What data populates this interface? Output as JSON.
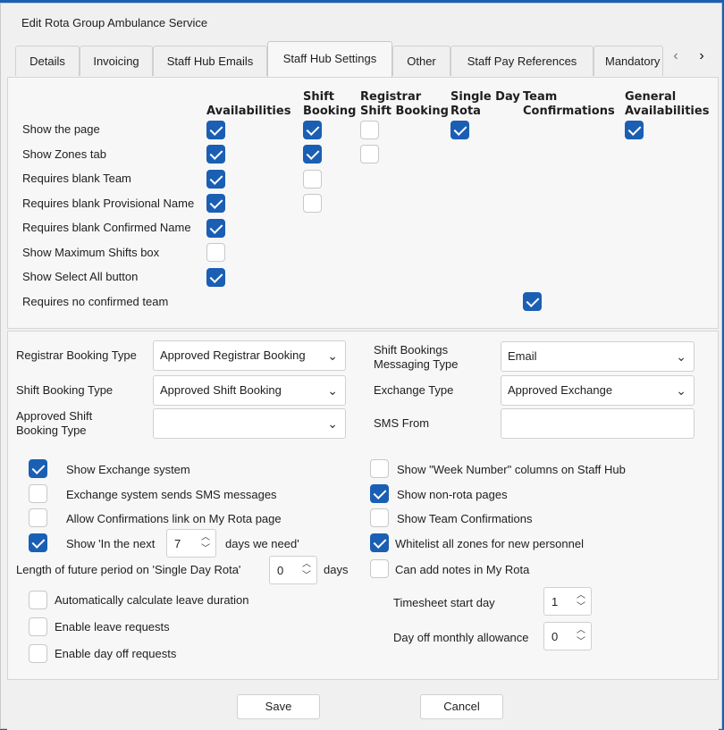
{
  "window": {
    "title": "Edit Rota Group Ambulance Service"
  },
  "tabs": [
    "Details",
    "Invoicing",
    "Staff Hub Emails",
    "Staff Hub Settings",
    "Other",
    "Staff Pay References",
    "Mandatory"
  ],
  "active_tab": "Staff Hub Settings",
  "grid": {
    "columns": [
      {
        "line1": "",
        "line2": "Availabilities"
      },
      {
        "line1": "Shift",
        "line2": "Booking"
      },
      {
        "line1": "Registrar",
        "line2": "Shift Booking"
      },
      {
        "line1": "Single Day",
        "line2": "Rota"
      },
      {
        "line1": "Team",
        "line2": "Confirmations"
      },
      {
        "line1": "General",
        "line2": "Availabilities"
      }
    ],
    "rows": [
      {
        "label": "Show the page",
        "checks": [
          true,
          true,
          false,
          true,
          null,
          true
        ]
      },
      {
        "label": "Show Zones tab",
        "checks": [
          true,
          true,
          false,
          null,
          null,
          null
        ]
      },
      {
        "label": "Requires blank Team",
        "checks": [
          true,
          false,
          null,
          null,
          null,
          null
        ]
      },
      {
        "label": "Requires blank Provisional  Name",
        "checks": [
          true,
          false,
          null,
          null,
          null,
          null
        ]
      },
      {
        "label": "Requires blank Confirmed Name",
        "checks": [
          true,
          null,
          null,
          null,
          null,
          null
        ]
      },
      {
        "label": "Show Maximum Shifts box",
        "checks": [
          false,
          null,
          null,
          null,
          null,
          null
        ]
      },
      {
        "label": "Show Select All button",
        "checks": [
          true,
          null,
          null,
          null,
          null,
          null
        ]
      },
      {
        "label": "Requires no confirmed team",
        "checks": [
          null,
          null,
          null,
          null,
          true,
          null
        ]
      }
    ]
  },
  "fields": {
    "registrar_booking_type": {
      "label": "Registrar Booking Type",
      "value": "Approved Registrar Booking"
    },
    "shift_booking_type": {
      "label": "Shift Booking Type",
      "value": "Approved Shift Booking"
    },
    "approved_shift_booking_type": {
      "label_line1": "Approved Shift",
      "label_line2": "Booking Type",
      "value": ""
    },
    "shift_bookings_messaging_type": {
      "label_line1": "Shift Bookings",
      "label_line2": "Messaging Type",
      "value": "Email"
    },
    "exchange_type": {
      "label": "Exchange Type",
      "value": "Approved Exchange"
    },
    "sms_from": {
      "label": "SMS From",
      "value": ""
    }
  },
  "options_left": {
    "show_exchange": {
      "label": "Show Exchange system",
      "checked": true
    },
    "exchange_sms": {
      "label": "Exchange system sends SMS messages",
      "checked": false
    },
    "allow_confirmations": {
      "label": "Allow Confirmations link on My Rota page",
      "checked": false
    },
    "show_in_next": {
      "label_before": "Show 'In the next",
      "value": "7",
      "label_after": "days we need'",
      "checked": true
    },
    "future_period": {
      "label_before": "Length of future period on 'Single Day Rota'",
      "value": "0",
      "label_after": "days"
    },
    "auto_leave": {
      "label": "Automatically calculate leave duration",
      "checked": false
    },
    "leave_requests": {
      "label": "Enable leave requests",
      "checked": false
    },
    "day_off_requests": {
      "label": "Enable day off requests",
      "checked": false
    }
  },
  "options_right": {
    "week_number": {
      "label": "Show \"Week Number\" columns on Staff Hub",
      "checked": false
    },
    "non_rota": {
      "label": "Show non-rota pages",
      "checked": true
    },
    "team_confirmations": {
      "label": "Show Team Confirmations",
      "checked": false
    },
    "whitelist_zones": {
      "label": "Whitelist all zones for new personnel",
      "checked": true
    },
    "add_notes": {
      "label": "Can add notes in My Rota",
      "checked": false
    },
    "timesheet_start": {
      "label": "Timesheet start day",
      "value": "1"
    },
    "day_off_allowance": {
      "label": "Day off monthly allowance",
      "value": "0"
    }
  },
  "buttons": {
    "save": "Save",
    "cancel": "Cancel"
  },
  "icons": {
    "chevron": "chevron-down-icon",
    "scroll_left": "chevron-left-icon",
    "scroll_right": "chevron-right-icon"
  },
  "colors": {
    "accent": "#1a5fb4"
  }
}
